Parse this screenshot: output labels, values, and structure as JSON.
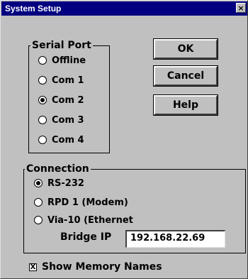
{
  "window": {
    "title": "System Setup",
    "close_glyph": "×"
  },
  "serial_port": {
    "legend": "Serial Port",
    "options": [
      {
        "label": "Offline",
        "checked": false
      },
      {
        "label": "Com 1",
        "checked": false
      },
      {
        "label": "Com 2",
        "checked": true
      },
      {
        "label": "Com 3",
        "checked": false
      },
      {
        "label": "Com 4",
        "checked": false
      }
    ]
  },
  "buttons": {
    "ok": "OK",
    "cancel": "Cancel",
    "help": "Help"
  },
  "connection": {
    "legend": "Connection",
    "options": [
      {
        "label": "RS-232",
        "checked": true
      },
      {
        "label": "RPD 1 (Modem)",
        "checked": false
      },
      {
        "label": "Via-10 (Ethernet",
        "checked": false
      }
    ],
    "bridge_ip_label": "Bridge IP",
    "bridge_ip_value": "192.168.22.69"
  },
  "show_memory": {
    "label": "Show Memory Names",
    "checked": true,
    "mark": "X"
  }
}
